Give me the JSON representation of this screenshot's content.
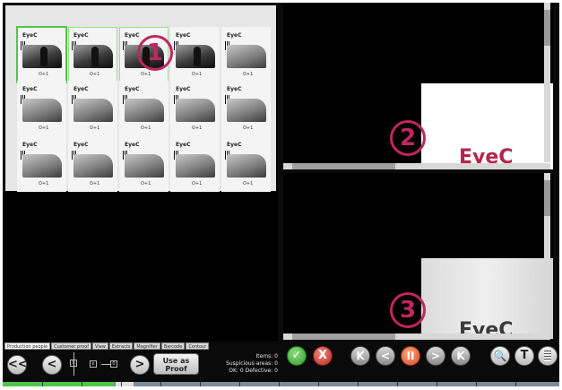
{
  "tabs": [
    {
      "label": "Production people",
      "active": true
    },
    {
      "label": "Customer proof",
      "active": false
    },
    {
      "label": "View",
      "active": false
    },
    {
      "label": "Extracts",
      "active": false
    },
    {
      "label": "Magnifier",
      "active": false
    },
    {
      "label": "Barcode",
      "active": false
    },
    {
      "label": "Contour",
      "active": false
    }
  ],
  "markers": {
    "one": "1",
    "two": "2",
    "three": "3"
  },
  "thumb_text": {
    "logo": "EyeC",
    "footer": "O+1"
  },
  "preview_text": {
    "brand": "EyeC"
  },
  "toolbar": {
    "first_label": "<<",
    "prev_label": "<",
    "next_label": ">",
    "use_as_proof": "Use as Proof",
    "accept_label": "✓",
    "reject_label": "X",
    "nav_first": "K",
    "nav_prev": "<",
    "nav_pause": "II",
    "nav_next": ">",
    "nav_last": "K",
    "text_tool": "T"
  },
  "stats": {
    "items": "Items: 0",
    "suspicious": "Suspicious areas: 0",
    "ok_defective": "OK: 0  Defective: 0"
  },
  "progress": {
    "filled_fraction": 0.2
  },
  "colors": {
    "accent": "#52c44a",
    "marker": "#c0265f",
    "reject": "#c0392b",
    "pause": "#e8643a"
  }
}
